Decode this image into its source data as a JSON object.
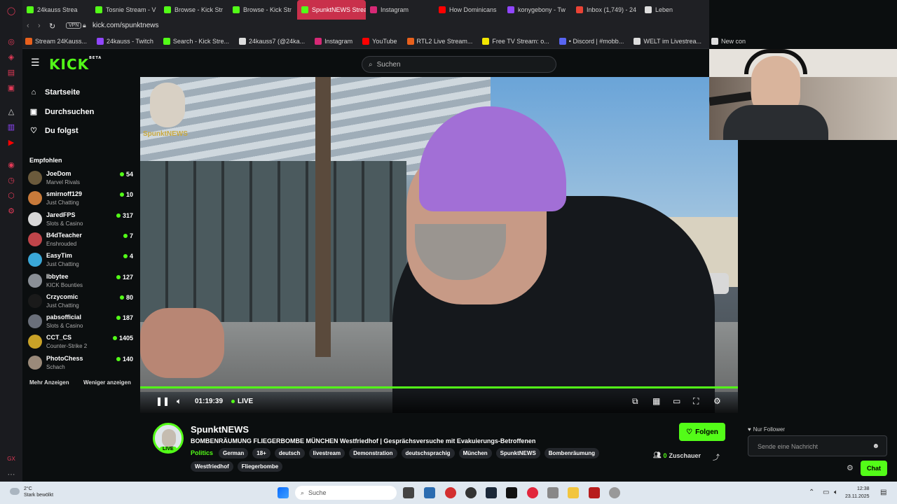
{
  "browser": {
    "tabs": [
      {
        "label": "24kauss Strea",
        "color": "#53fc18",
        "active": false
      },
      {
        "label": "Tosnie Stream - V",
        "color": "#53fc18",
        "active": false
      },
      {
        "label": "Browse - Kick Str",
        "color": "#53fc18",
        "active": false
      },
      {
        "label": "Browse - Kick Str",
        "color": "#53fc18",
        "active": false
      },
      {
        "label": "SpunktNEWS Stream",
        "color": "#53fc18",
        "active": true
      },
      {
        "label": "Instagram",
        "color": "#d62976",
        "active": false
      },
      {
        "label": "How Dominicans",
        "color": "#ff0000",
        "active": false
      },
      {
        "label": "konygebony - Tw",
        "color": "#9146ff",
        "active": false
      },
      {
        "label": "Inbox (1,749) - 24",
        "color": "#ea4335",
        "active": false
      },
      {
        "label": "Leben",
        "color": "#dddddd",
        "active": false
      }
    ],
    "vpn_label": "VPN",
    "url": "kick.com/spunktnews",
    "bookmarks": [
      {
        "label": "Stream 24Kauss...",
        "color": "#e8601c"
      },
      {
        "label": "24kauss - Twitch",
        "color": "#9146ff"
      },
      {
        "label": "Search - Kick Stre...",
        "color": "#53fc18"
      },
      {
        "label": "24kauss7 (@24ka...",
        "color": "#dddddd"
      },
      {
        "label": "Instagram",
        "color": "#d62976"
      },
      {
        "label": "YouTube",
        "color": "#ff0000"
      },
      {
        "label": "RTL2 Live Stream...",
        "color": "#e8601c"
      },
      {
        "label": "Free TV Stream: o...",
        "color": "#f2e600"
      },
      {
        "label": "• Discord | #mobb...",
        "color": "#5865f2"
      },
      {
        "label": "WELT im Livestrea...",
        "color": "#dddddd"
      },
      {
        "label": "New con",
        "color": "#dddddd"
      }
    ]
  },
  "kick": {
    "logo": "KICK",
    "logo_sup": "BETA",
    "search_placeholder": "Suchen",
    "nav": [
      {
        "label": "Startseite",
        "icon": "home-icon",
        "glyph": "⌂"
      },
      {
        "label": "Durchsuchen",
        "icon": "browse-icon",
        "glyph": "▣"
      },
      {
        "label": "Du folgst",
        "icon": "heart-icon",
        "glyph": "♡"
      }
    ],
    "recommended_title": "Empfohlen",
    "channels": [
      {
        "name": "JoeDom",
        "category": "Marvel Rivals",
        "viewers": "54",
        "color": "#6b5a3c"
      },
      {
        "name": "smirnoff129",
        "category": "Just Chatting",
        "viewers": "10",
        "color": "#c87a3a"
      },
      {
        "name": "JaredFPS",
        "category": "Slots & Casino",
        "viewers": "317",
        "color": "#d8d8d8"
      },
      {
        "name": "B4dTeacher",
        "category": "Enshrouded",
        "viewers": "7",
        "color": "#c0454a"
      },
      {
        "name": "EasyTim",
        "category": "Just Chatting",
        "viewers": "4",
        "color": "#3aa8d8"
      },
      {
        "name": "Ibbytee",
        "category": "KICK Bounties",
        "viewers": "127",
        "color": "#8a8f96"
      },
      {
        "name": "Crzycomic",
        "category": "Just Chatting",
        "viewers": "80",
        "color": "#1a1a1a"
      },
      {
        "name": "pabsofficial",
        "category": "Slots & Casino",
        "viewers": "187",
        "color": "#6a6f7a"
      },
      {
        "name": "CCT_CS",
        "category": "Counter-Strike 2",
        "viewers": "1405",
        "color": "#c9a227"
      },
      {
        "name": "PhotoChess",
        "category": "Schach",
        "viewers": "140",
        "color": "#9a8a7a"
      }
    ],
    "show_more": "Mehr Anzeigen",
    "show_less": "Weniger anzeigen"
  },
  "player": {
    "watermark": "SpunktNEWS",
    "time": "01:19:39",
    "live_label": "LIVE",
    "progress": 1.0
  },
  "stream": {
    "channel_name": "SpunktNEWS",
    "live_badge": "LIVE",
    "title": "BOMBENRÄUMUNG FLIEGERBOMBE MÜNCHEN Westfriedhof | Gesprächsversuche mit Evakuierungs-Betroffenen",
    "category": "Politics",
    "tags": [
      "German",
      "18+",
      "deutsch",
      "livestream",
      "Demonstration",
      "deutschsprachig",
      "München",
      "SpunktNEWS",
      "Bombenräumung",
      "Westfriedhof",
      "Fliegerbombe"
    ],
    "follow_label": "Folgen",
    "viewer_count": "0",
    "viewer_label": "Zuschauer"
  },
  "chat": {
    "followers_only": "Nur Follower",
    "input_placeholder": "Sende eine Nachricht",
    "chat_button": "Chat"
  },
  "taskbar": {
    "weather_temp": "2°C",
    "weather_desc": "Stark bewölkt",
    "search_label": "Suche",
    "time": "12:38",
    "date": "23.11.2025"
  }
}
